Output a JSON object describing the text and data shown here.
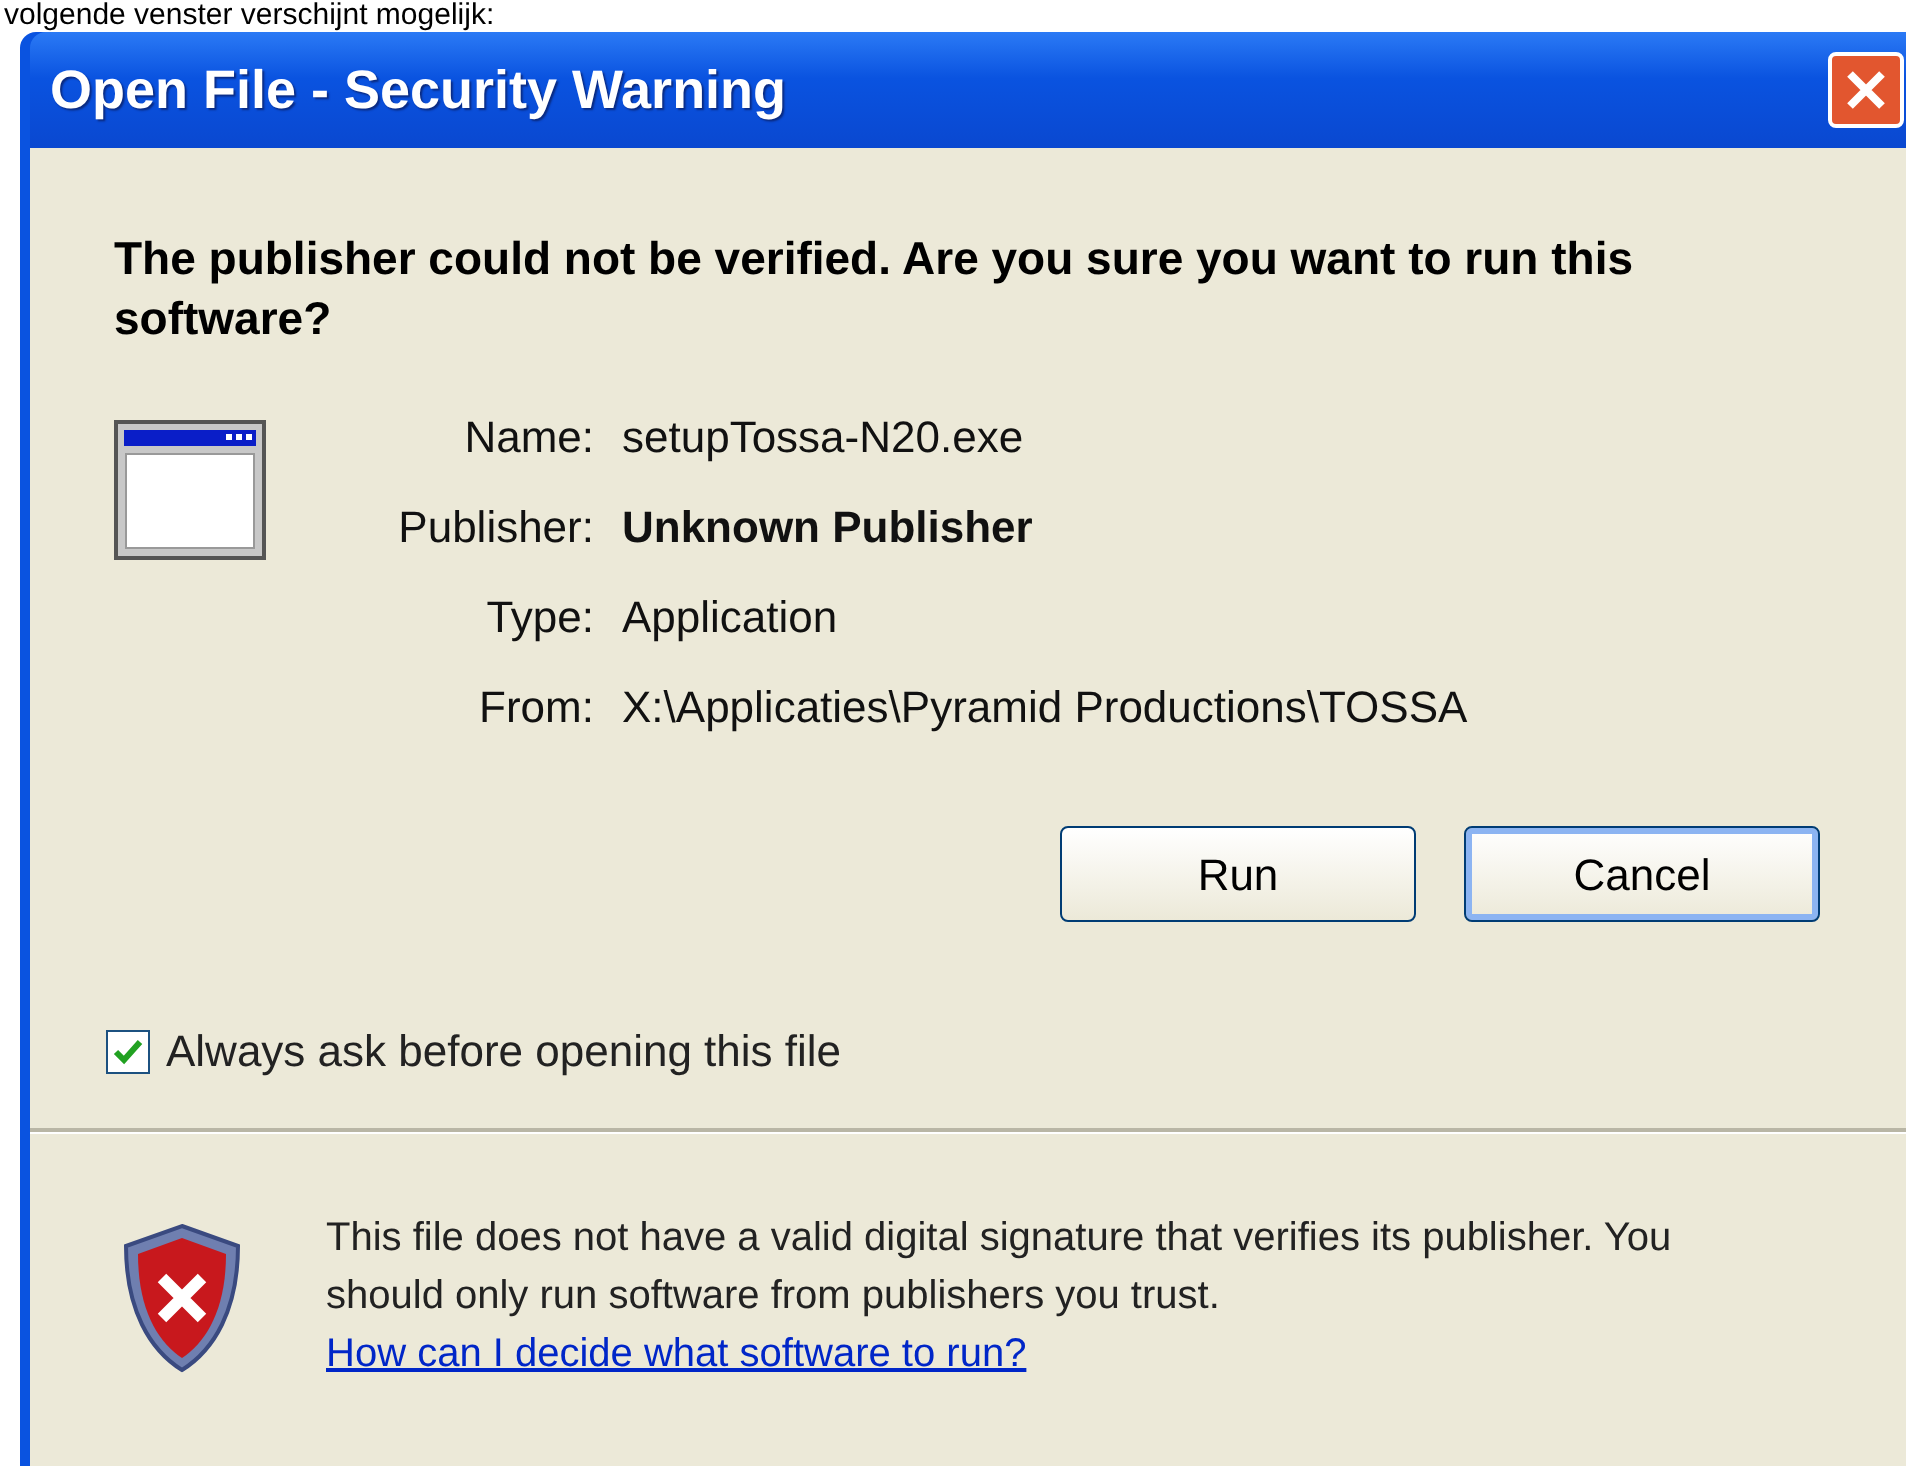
{
  "page_text": "volgende venster verschijnt mogelijk:",
  "window": {
    "title": "Open File - Security Warning"
  },
  "heading": "The publisher could not be verified.  Are you sure you want to run this software?",
  "details": [
    {
      "label": "Name:",
      "value": "setupTossa-N20.exe",
      "bold": false
    },
    {
      "label": "Publisher:",
      "value": "Unknown Publisher",
      "bold": true
    },
    {
      "label": "Type:",
      "value": "Application",
      "bold": false
    },
    {
      "label": "From:",
      "value": "X:\\Applicaties\\Pyramid Productions\\TOSSA",
      "bold": false
    }
  ],
  "buttons": [
    {
      "label": "Run",
      "selected": false
    },
    {
      "label": "Cancel",
      "selected": true
    }
  ],
  "always_ask": {
    "label": "Always ask before opening this file",
    "checked": true
  },
  "warning": {
    "text": "This file does not have a valid digital signature that verifies its publisher.  You should only run software from publishers you trust.",
    "link": "How can I decide what software to run?"
  }
}
